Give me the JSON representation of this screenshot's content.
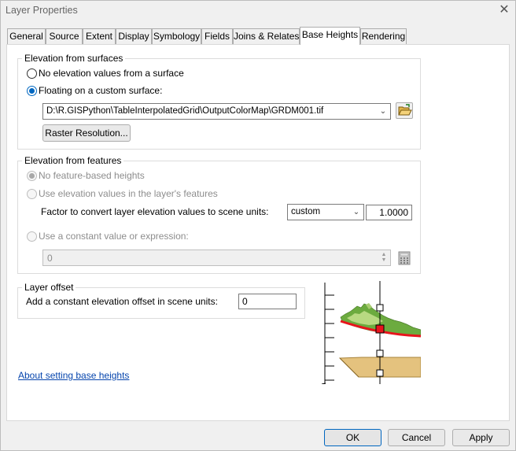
{
  "window": {
    "title": "Layer Properties",
    "close_glyph": "✕"
  },
  "tabs": [
    {
      "label": "General"
    },
    {
      "label": "Source"
    },
    {
      "label": "Extent"
    },
    {
      "label": "Display"
    },
    {
      "label": "Symbology"
    },
    {
      "label": "Fields"
    },
    {
      "label": "Joins & Relates"
    },
    {
      "label": "Base Heights",
      "active": true
    },
    {
      "label": "Rendering"
    }
  ],
  "surfaces": {
    "legend": "Elevation from surfaces",
    "opt_none": "No elevation values from a surface",
    "opt_float": "Floating on a custom surface:",
    "selected": "float",
    "surface_path": "D:\\R.GISPython\\TableInterpolatedGrid\\OutputColorMap\\GRDM001.tif",
    "raster_button": "Raster Resolution...",
    "browse_icon": "open-folder-icon"
  },
  "features": {
    "legend": "Elevation from features",
    "opt_none": "No feature-based heights",
    "opt_values": "Use elevation values in the layer's features",
    "factor_label": "Factor to convert layer elevation values to scene units:",
    "unit_select": "custom",
    "factor_value": "1.0000",
    "opt_constant": "Use a constant value or expression:",
    "expression_value": "0",
    "calculator_icon": "calculator-icon",
    "enabled": false
  },
  "offset": {
    "legend": "Layer offset",
    "label": "Add a constant elevation offset in scene units:",
    "value": "0"
  },
  "help_link": "About setting base heights",
  "buttons": {
    "ok": "OK",
    "cancel": "Cancel",
    "apply": "Apply"
  },
  "colors": {
    "accent": "#0067c0",
    "link": "#0645ad",
    "terrain_green": "#6cab3f",
    "marker_red": "#e8141c",
    "plane_tan": "#e4c27e"
  }
}
